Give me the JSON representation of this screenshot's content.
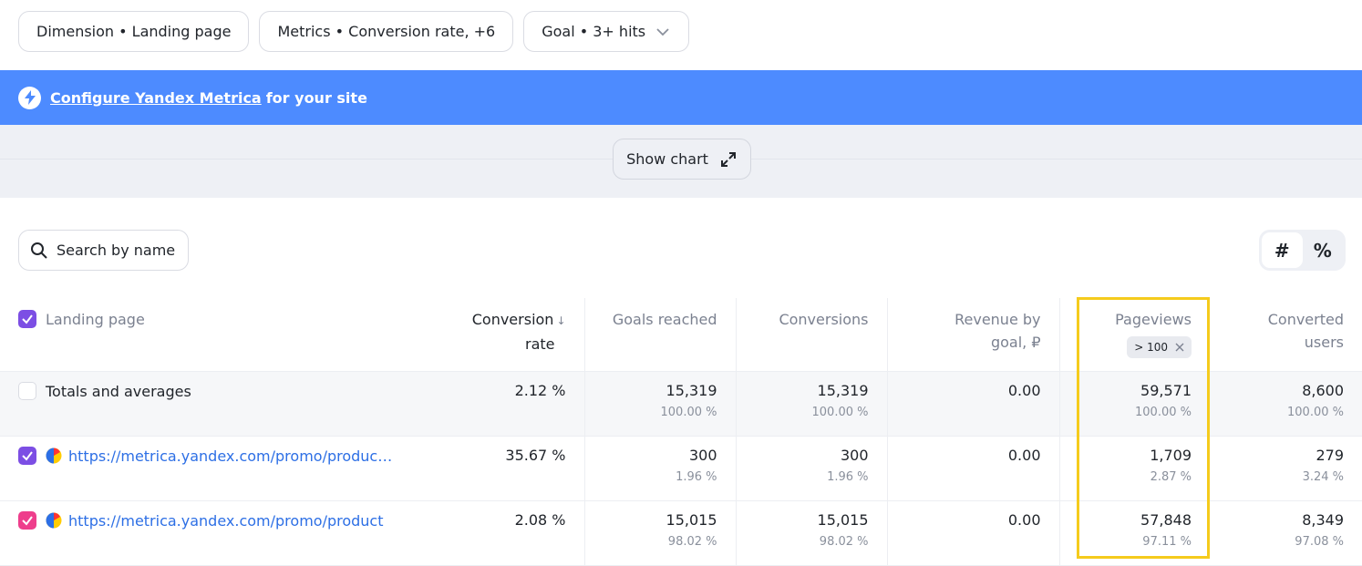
{
  "filters": {
    "dimension": "Dimension • Landing page",
    "metrics": "Metrics • Conversion rate, +6",
    "goal": "Goal • 3+ hits"
  },
  "banner": {
    "link_text": "Configure Yandex Metrica",
    "rest_text": "for your site"
  },
  "chart_toggle": {
    "label": "Show chart"
  },
  "search": {
    "placeholder": "Search by name"
  },
  "view_toggle": {
    "absolute": "#",
    "percent": "%"
  },
  "table": {
    "headers": {
      "landing_page": "Landing page",
      "conversion_rate_1": "Conversion",
      "conversion_rate_2": "rate",
      "sort_indicator": "↓",
      "goals_reached": "Goals reached",
      "conversions": "Conversions",
      "revenue_1": "Revenue by",
      "revenue_2": "goal, ₽",
      "pageviews": "Pageviews",
      "pageviews_filter": "> 100",
      "converted_users_1": "Converted",
      "converted_users_2": "users"
    },
    "rows": [
      {
        "label": "Totals and averages",
        "conversion_rate": "2.12 %",
        "goals_reached": "15,319",
        "goals_reached_pct": "100.00 %",
        "conversions": "15,319",
        "conversions_pct": "100.00 %",
        "revenue": "0.00",
        "pageviews": "59,571",
        "pageviews_pct": "100.00 %",
        "converted_users": "8,600",
        "converted_users_pct": "100.00 %"
      },
      {
        "label": "https://metrica.yandex.com/promo/produc…",
        "conversion_rate": "35.67 %",
        "goals_reached": "300",
        "goals_reached_pct": "1.96 %",
        "conversions": "300",
        "conversions_pct": "1.96 %",
        "revenue": "0.00",
        "pageviews": "1,709",
        "pageviews_pct": "2.87 %",
        "converted_users": "279",
        "converted_users_pct": "3.24 %"
      },
      {
        "label": "https://metrica.yandex.com/promo/product",
        "conversion_rate": "2.08 %",
        "goals_reached": "15,015",
        "goals_reached_pct": "98.02 %",
        "conversions": "15,015",
        "conversions_pct": "98.02 %",
        "revenue": "0.00",
        "pageviews": "57,848",
        "pageviews_pct": "97.11 %",
        "converted_users": "8,349",
        "converted_users_pct": "97.08 %"
      }
    ]
  },
  "colors": {
    "banner": "#4d8bff",
    "checkbox_row1": "#7c4ee4",
    "checkbox_row2": "#ee3e8c",
    "highlight": "#f5cb1c",
    "link": "#2d6fe5"
  }
}
